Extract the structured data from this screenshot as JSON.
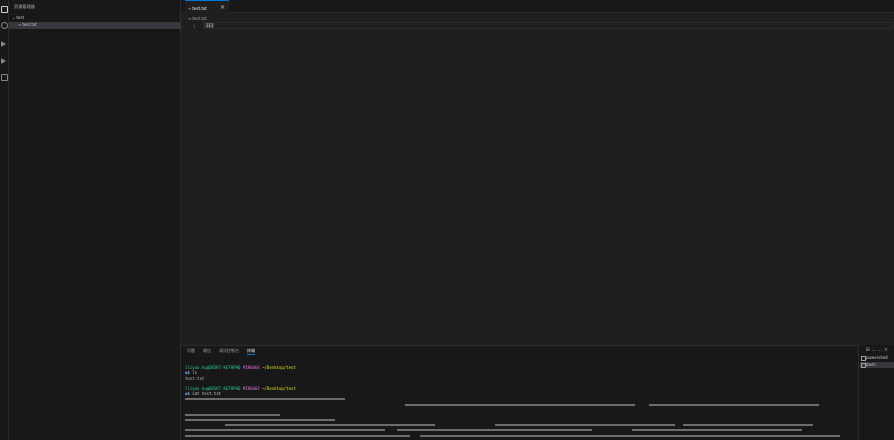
{
  "sidebar": {
    "title": "资源管理器",
    "folder": "test",
    "file": "test.txt"
  },
  "editor": {
    "tab_label": "test.txt",
    "close_glyph": "×",
    "breadcrumb": "test.txt",
    "line_number": "1",
    "line_text": "111"
  },
  "panel": {
    "tabs": [
      "问题",
      "输出",
      "调试控制台",
      "终端"
    ],
    "active_tab_index": 3,
    "terminal": {
      "prompt1_user": "lliyao.hu@DESKT-KETHPHQ",
      "prompt1_shell": "MINGW64",
      "prompt1_path": "~/Desktop/test",
      "cmd1": "$ ls",
      "out1": "test.txt",
      "prompt2_user": "lliyao.hu@DESKT-KETHPHQ",
      "prompt2_shell": "MINGW64",
      "prompt2_path": "~/Desktop/test",
      "cmd2": "$ cat test.txt"
    }
  },
  "sessions": {
    "controls": "⊞ ⌄ … ×",
    "items": [
      "powershell",
      "bash"
    ]
  },
  "colors": {
    "accent": "#0078d4",
    "prompt_user": "#23d18b",
    "prompt_shell": "#d670d6",
    "prompt_path": "#e5e510"
  }
}
